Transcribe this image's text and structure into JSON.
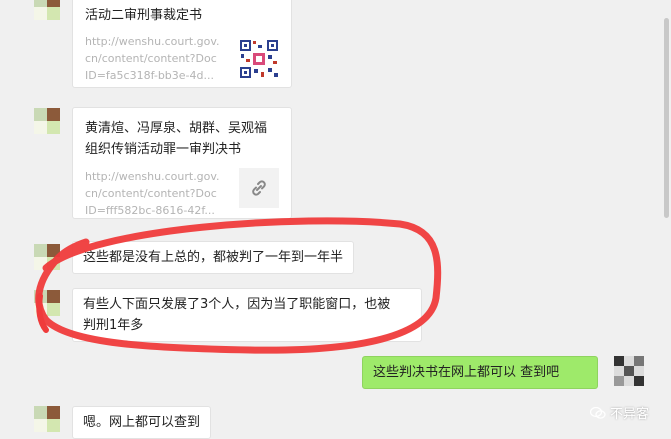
{
  "chat": {
    "messages": [
      {
        "type": "link-card",
        "title": "活动二审刑事裁定书",
        "url": "http://wenshu.court.gov.\ncn/content/content?Doc\nID=fa5c318f-bb3e-4d..."
      },
      {
        "type": "link-card",
        "title": "黄清煊、冯厚泉、胡群、吴观福\n组织传销活动罪一审判决书",
        "url": "http://wenshu.court.gov.\ncn/content/content?Doc\nID=fff582bc-8616-42f..."
      },
      {
        "type": "text",
        "text": "这些都是没有上总的，都被判了一年到一年半"
      },
      {
        "type": "text",
        "text": "有些人下面只发展了3个人，因为当了职能窗口，也被\n判刑1年多"
      },
      {
        "type": "text",
        "from": "me",
        "text": "这些判决书在网上都可以 查到吧"
      },
      {
        "type": "text",
        "text": "嗯。网上都可以查到"
      }
    ]
  },
  "watermark": {
    "text": "不异客"
  },
  "colors": {
    "my_bubble": "#9eea6a",
    "annotation": "#ef3b3b"
  }
}
